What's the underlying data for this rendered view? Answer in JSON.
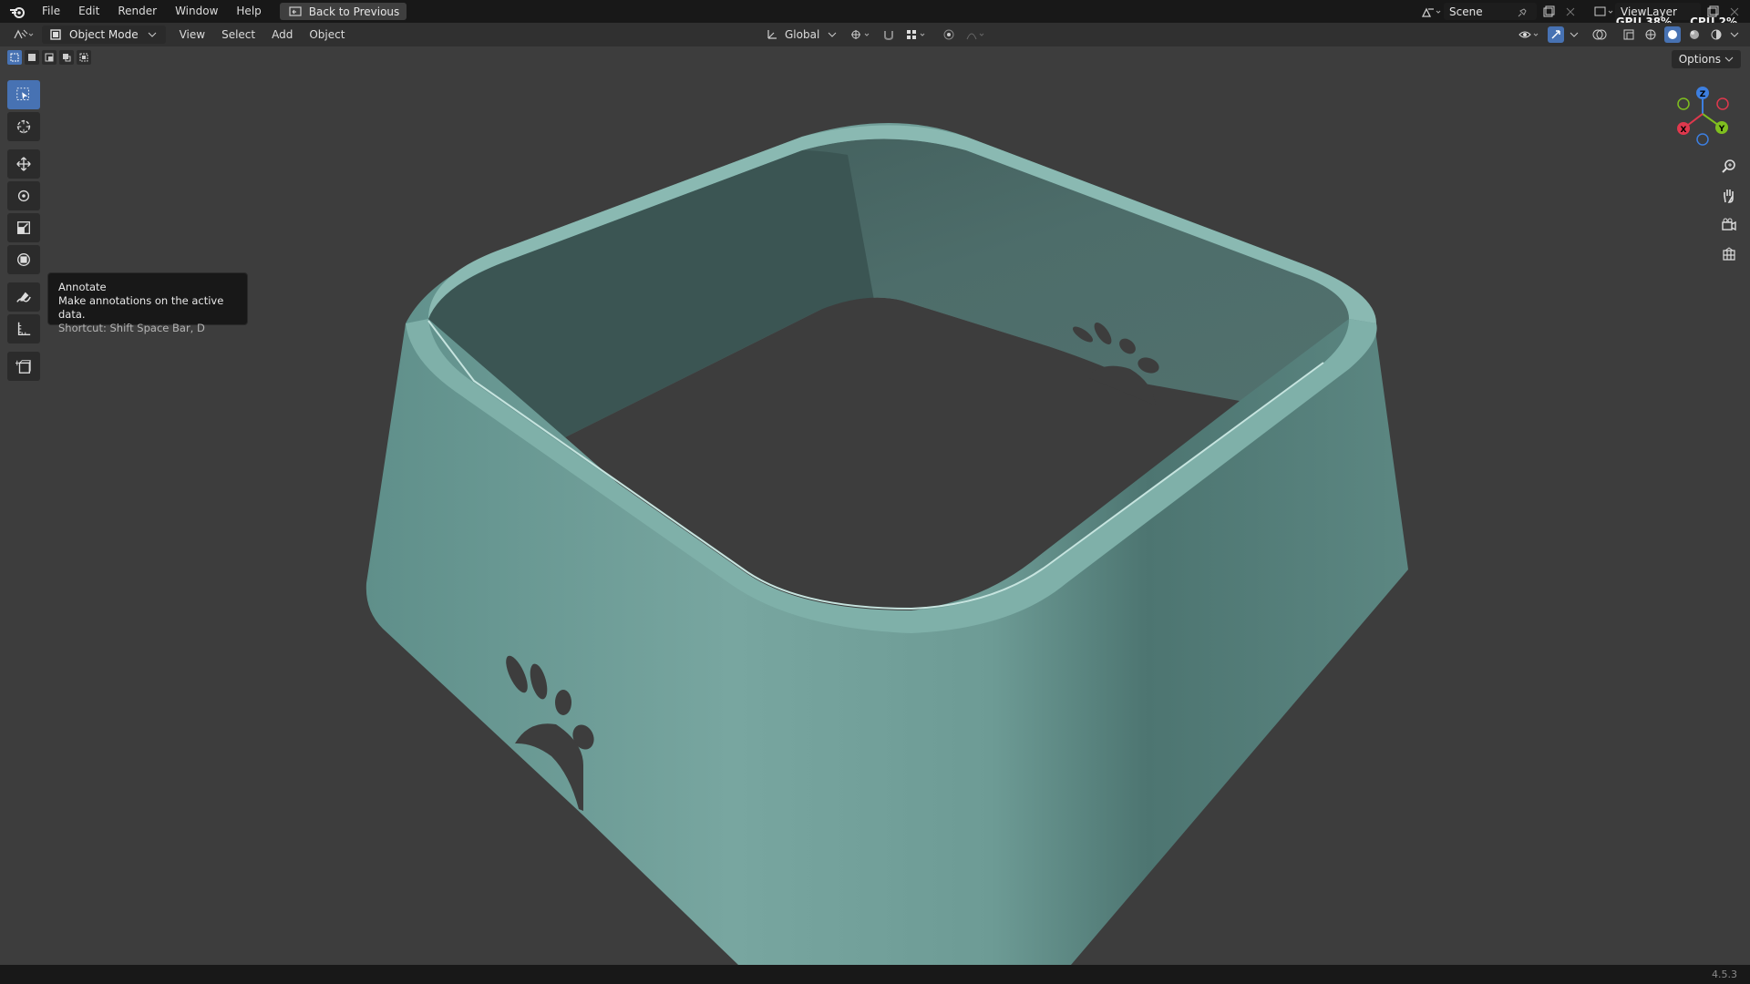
{
  "menubar": {
    "items": [
      "File",
      "Edit",
      "Render",
      "Window",
      "Help"
    ],
    "back_button": "Back to Previous"
  },
  "scene": {
    "label": "Scene"
  },
  "view_layer": {
    "label": "ViewLayer"
  },
  "stats": {
    "gpu": "GPU 38%",
    "cpu": "CPU 2%"
  },
  "header": {
    "mode": "Object Mode",
    "menus": [
      "View",
      "Select",
      "Add",
      "Object"
    ],
    "transform_orientation": "Global"
  },
  "options_label": "Options",
  "tooltip": {
    "title": "Annotate",
    "description": "Make annotations on the active data.",
    "shortcut": "Shortcut: Shift Space Bar, D"
  },
  "gizmo": {
    "z": "Z",
    "y": "Y",
    "x": "X"
  },
  "status": {
    "version": "4.5.3"
  },
  "colors": {
    "accent": "#4772b3",
    "model": "#6f9d97",
    "viewport": "#3d3d3d",
    "axis_x": "#e0384d",
    "axis_y": "#7fbf1f",
    "axis_z": "#3d7fe0"
  },
  "icons": {
    "app": "blender-logo-icon",
    "tools": [
      "select-box-icon",
      "cursor-icon",
      "move-icon",
      "rotate-icon",
      "scale-icon",
      "transform-icon",
      "annotate-icon",
      "measure-icon",
      "add-cube-icon"
    ],
    "navigation": [
      "zoom-icon",
      "pan-hand-icon",
      "camera-icon",
      "grid-view-icon"
    ]
  }
}
